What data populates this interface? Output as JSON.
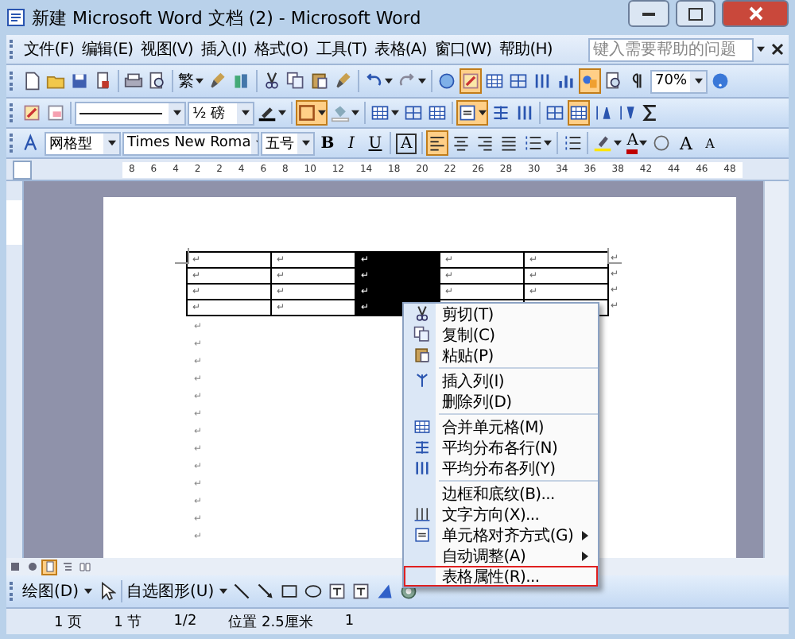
{
  "window": {
    "title": "新建 Microsoft Word 文档 (2) - Microsoft Word"
  },
  "menu": [
    {
      "label": "文件(F)"
    },
    {
      "label": "编辑(E)"
    },
    {
      "label": "视图(V)"
    },
    {
      "label": "插入(I)"
    },
    {
      "label": "格式(O)"
    },
    {
      "label": "工具(T)"
    },
    {
      "label": "表格(A)"
    },
    {
      "label": "窗口(W)"
    },
    {
      "label": "帮助(H)"
    }
  ],
  "help_box": {
    "placeholder": "键入需要帮助的问题"
  },
  "toolbars": [
    [
      {
        "kind": "button",
        "pressed": false
      },
      {
        "kind": "button",
        "pressed": false
      },
      {
        "kind": "button",
        "pressed": false
      },
      {
        "kind": "button",
        "pressed": false
      },
      {
        "kind": "sep"
      },
      {
        "kind": "button",
        "pressed": false
      },
      {
        "kind": "button",
        "pressed": false
      },
      {
        "kind": "sep"
      },
      {
        "kind": "text",
        "label": "繁"
      },
      {
        "kind": "button",
        "pressed": false
      },
      {
        "kind": "button",
        "pressed": false
      },
      {
        "kind": "sep"
      },
      {
        "kind": "button",
        "pressed": false
      },
      {
        "kind": "button",
        "pressed": false
      },
      {
        "kind": "button",
        "pressed": false
      },
      {
        "kind": "button",
        "pressed": false
      },
      {
        "kind": "sep"
      },
      {
        "kind": "button",
        "pressed": false
      },
      {
        "kind": "button",
        "pressed": false
      },
      {
        "kind": "sep"
      },
      {
        "kind": "button",
        "pressed": false
      },
      {
        "kind": "button",
        "pressed": true
      },
      {
        "kind": "button",
        "pressed": false
      },
      {
        "kind": "button",
        "pressed": false
      },
      {
        "kind": "button",
        "pressed": false
      },
      {
        "kind": "button",
        "pressed": false
      },
      {
        "kind": "button",
        "pressed": true
      },
      {
        "kind": "button",
        "pressed": false
      },
      {
        "kind": "button",
        "pressed": false
      },
      {
        "kind": "combo",
        "value": "70%"
      },
      {
        "kind": "button",
        "pressed": false
      }
    ],
    [
      {
        "kind": "button",
        "pressed": false
      },
      {
        "kind": "button",
        "pressed": false
      },
      {
        "kind": "sep"
      },
      {
        "kind": "line-combo"
      },
      {
        "kind": "combo",
        "value": "½ 磅"
      },
      {
        "kind": "button",
        "pressed": false
      },
      {
        "kind": "sep"
      },
      {
        "kind": "button",
        "pressed": true
      },
      {
        "kind": "button",
        "pressed": false
      },
      {
        "kind": "sep"
      },
      {
        "kind": "button",
        "pressed": false
      },
      {
        "kind": "button",
        "pressed": false
      },
      {
        "kind": "button",
        "pressed": false
      },
      {
        "kind": "sep"
      },
      {
        "kind": "button",
        "pressed": true
      },
      {
        "kind": "button",
        "pressed": false
      },
      {
        "kind": "button",
        "pressed": false
      },
      {
        "kind": "sep"
      },
      {
        "kind": "button",
        "pressed": false
      },
      {
        "kind": "button",
        "pressed": true
      },
      {
        "kind": "button",
        "pressed": false
      },
      {
        "kind": "button",
        "pressed": false
      },
      {
        "kind": "button",
        "pressed": false
      }
    ],
    [
      {
        "kind": "button",
        "pressed": false
      },
      {
        "kind": "combo",
        "value": "网格型"
      },
      {
        "kind": "combo",
        "value": "Times New Roma"
      },
      {
        "kind": "combo",
        "value": "五号"
      },
      {
        "kind": "text",
        "label": "B"
      },
      {
        "kind": "text",
        "label": "I"
      },
      {
        "kind": "text",
        "label": "U"
      },
      {
        "kind": "sep"
      },
      {
        "kind": "text",
        "label": "A"
      },
      {
        "kind": "sep"
      },
      {
        "kind": "button",
        "pressed": true
      },
      {
        "kind": "button",
        "pressed": false
      },
      {
        "kind": "button",
        "pressed": false
      },
      {
        "kind": "button",
        "pressed": false
      },
      {
        "kind": "button",
        "pressed": false
      },
      {
        "kind": "sep"
      },
      {
        "kind": "button",
        "pressed": false
      },
      {
        "kind": "sep"
      },
      {
        "kind": "button",
        "pressed": false
      },
      {
        "kind": "text",
        "label": "A"
      },
      {
        "kind": "button",
        "pressed": false
      },
      {
        "kind": "text",
        "label": "A"
      },
      {
        "kind": "text",
        "label": "A"
      }
    ]
  ],
  "ruler": {
    "ticks": [
      "8",
      "6",
      "4",
      "2",
      "2",
      "4",
      "6",
      "8",
      "10",
      "12",
      "14",
      "18",
      "20",
      "22",
      "26",
      "28",
      "30",
      "34",
      "36",
      "38",
      "42",
      "44",
      "46",
      "48"
    ]
  },
  "table": {
    "rows": [
      [
        {
          "mark": "↵",
          "selected": false
        },
        {
          "mark": "↵",
          "selected": false
        },
        {
          "mark": "↵",
          "selected": true
        },
        {
          "mark": "↵",
          "selected": false
        },
        {
          "mark": "↵",
          "selected": false
        },
        {
          "mark": "↵"
        }
      ],
      [
        {
          "mark": "↵",
          "selected": false
        },
        {
          "mark": "↵",
          "selected": false
        },
        {
          "mark": "↵",
          "selected": true
        },
        {
          "mark": "↵",
          "selected": false
        },
        {
          "mark": "↵",
          "selected": false
        },
        {
          "mark": "↵"
        }
      ],
      [
        {
          "mark": "↵",
          "selected": false
        },
        {
          "mark": "↵",
          "selected": false
        },
        {
          "mark": "↵",
          "selected": true
        },
        {
          "mark": "↵",
          "selected": false
        },
        {
          "mark": "↵",
          "selected": false
        },
        {
          "mark": "↵"
        }
      ],
      [
        {
          "mark": "↵",
          "selected": false
        },
        {
          "mark": "↵",
          "selected": false
        },
        {
          "mark": "↵",
          "selected": true
        },
        {},
        {
          "selected": false
        },
        {
          "mark": "↵"
        }
      ]
    ]
  },
  "paragraph_marks": [
    "↵",
    "↵",
    "↵",
    "↵",
    "↵",
    "↵",
    "↵",
    "↵",
    "↵",
    "↵",
    "↵",
    "↵",
    "↵"
  ],
  "view_buttons": [
    {
      "selected": false
    },
    {
      "selected": false
    },
    {
      "selected": true
    },
    {
      "selected": false
    },
    {
      "selected": false
    }
  ],
  "drawing_toolbar": [
    {
      "kind": "menu",
      "label": "绘图(D)"
    },
    {
      "kind": "button"
    },
    {
      "kind": "sep"
    },
    {
      "kind": "menu",
      "label": "自选图形(U)"
    },
    {
      "kind": "button"
    },
    {
      "kind": "button"
    },
    {
      "kind": "button"
    },
    {
      "kind": "button"
    },
    {
      "kind": "button"
    },
    {
      "kind": "button"
    },
    {
      "kind": "button"
    },
    {
      "kind": "button"
    }
  ],
  "status_bar": [
    "1 页",
    "1 节",
    "1/2",
    "位置 2.5厘米",
    "1"
  ],
  "context_menu": [
    {
      "kind": "item",
      "label": "剪切(T)",
      "submenu": false,
      "highlighted": false
    },
    {
      "kind": "item",
      "label": "复制(C)",
      "submenu": false,
      "highlighted": false
    },
    {
      "kind": "item",
      "label": "粘贴(P)",
      "submenu": false,
      "highlighted": false
    },
    {
      "kind": "sep"
    },
    {
      "kind": "item",
      "label": "插入列(I)",
      "submenu": false,
      "highlighted": false
    },
    {
      "kind": "item",
      "label": "删除列(D)",
      "submenu": false,
      "highlighted": false
    },
    {
      "kind": "sep"
    },
    {
      "kind": "item",
      "label": "合并单元格(M)",
      "submenu": false,
      "highlighted": false
    },
    {
      "kind": "item",
      "label": "平均分布各行(N)",
      "submenu": false,
      "highlighted": false
    },
    {
      "kind": "item",
      "label": "平均分布各列(Y)",
      "submenu": false,
      "highlighted": false
    },
    {
      "kind": "sep"
    },
    {
      "kind": "item",
      "label": "边框和底纹(B)...",
      "submenu": false,
      "highlighted": false
    },
    {
      "kind": "item",
      "label": "文字方向(X)...",
      "submenu": false,
      "highlighted": false
    },
    {
      "kind": "item",
      "label": "单元格对齐方式(G)",
      "submenu": true,
      "highlighted": false
    },
    {
      "kind": "item",
      "label": "自动调整(A)",
      "submenu": true,
      "highlighted": false
    },
    {
      "kind": "item",
      "label": "表格属性(R)...",
      "submenu": false,
      "highlighted": true
    }
  ]
}
